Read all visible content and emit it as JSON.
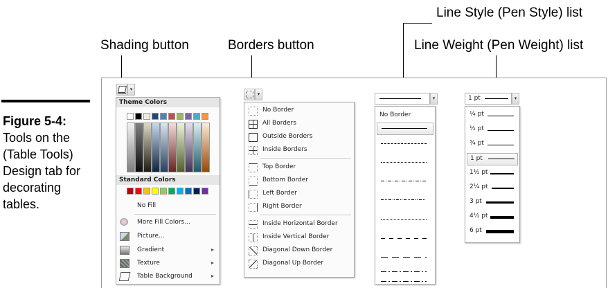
{
  "callouts": {
    "shading": "Shading button",
    "borders": "Borders button",
    "line_style": "Line Style (Pen Style) list",
    "line_weight": "Line Weight (Pen Weight) list"
  },
  "caption": {
    "figure": "Figure 5-4",
    "text": "Tools on the (Table Tools) Design tab for decorating tables."
  },
  "shading_menu": {
    "theme_colors": "Theme Colors",
    "standard_colors": "Standard Colors",
    "items": [
      {
        "label": "No Fill",
        "icon": "none"
      },
      {
        "label": "More Fill Colors...",
        "icon": "palette-icon"
      },
      {
        "label": "Picture...",
        "icon": "picture-icon"
      },
      {
        "label": "Gradient",
        "icon": "gradient-icon",
        "submenu": true
      },
      {
        "label": "Texture",
        "icon": "texture-icon",
        "submenu": true
      },
      {
        "label": "Table Background",
        "icon": "paint-bucket-icon",
        "submenu": true
      }
    ],
    "theme_top": [
      "#ffffff",
      "#000000",
      "#eeece1",
      "#1f497d",
      "#4f81bd",
      "#c0504d",
      "#9bbb59",
      "#8064a2",
      "#4bacc6",
      "#f79646"
    ],
    "standard": [
      "#c00000",
      "#ff0000",
      "#ffc000",
      "#ffff00",
      "#92d050",
      "#00b050",
      "#00b0f0",
      "#0070c0",
      "#002060",
      "#7030a0"
    ]
  },
  "borders_menu": {
    "items": [
      "No Border",
      "All Borders",
      "Outside Borders",
      "Inside Borders",
      "Top Border",
      "Bottom Border",
      "Left Border",
      "Right Border",
      "Inside Horizontal Border",
      "Inside Vertical Border",
      "Diagonal Down Border",
      "Diagonal Up Border"
    ]
  },
  "line_style": {
    "no_border": "No Border"
  },
  "line_weight": {
    "current": "1 pt",
    "options": [
      "¼ pt",
      "½ pt",
      "¾ pt",
      "1 pt",
      "1½ pt",
      "2¼ pt",
      "3 pt",
      "4½ pt",
      "6 pt"
    ],
    "selected_index": 3
  }
}
